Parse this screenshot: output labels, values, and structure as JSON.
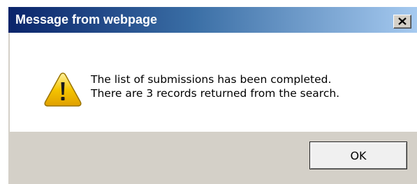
{
  "dialog": {
    "title": "Message from webpage",
    "close_icon": "close-icon",
    "icon": "warning-icon",
    "message_lines": [
      "The list of submissions has been completed.",
      "There are 3 records returned from the search."
    ],
    "ok_label": "OK"
  },
  "colors": {
    "titlebar_start": "#0a246a",
    "titlebar_end": "#a6caf0",
    "dialog_bg": "#d4d0c8",
    "content_bg": "#ffffff",
    "warning_yellow": "#f5c400"
  }
}
